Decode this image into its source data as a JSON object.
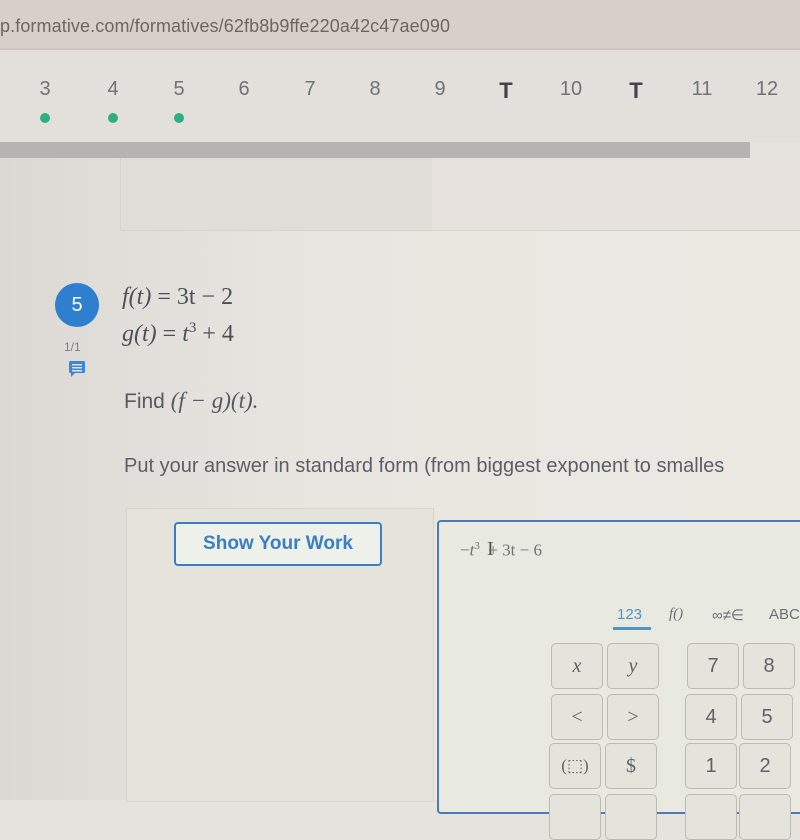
{
  "browser": {
    "url": "p.formative.com/formatives/62fb8b9ffe220a42c47ae090"
  },
  "question_nav": {
    "items": [
      {
        "label": "3",
        "answered": true
      },
      {
        "label": "4",
        "answered": true
      },
      {
        "label": "5",
        "answered": true
      },
      {
        "label": "6",
        "answered": false
      },
      {
        "label": "7",
        "answered": false
      },
      {
        "label": "8",
        "answered": false
      },
      {
        "label": "9",
        "answered": false
      },
      {
        "label": "T",
        "answered": false,
        "type": "text"
      },
      {
        "label": "10",
        "answered": false
      },
      {
        "label": "T",
        "answered": false,
        "type": "text"
      },
      {
        "label": "11",
        "answered": false
      },
      {
        "label": "12",
        "answered": false
      }
    ],
    "answered_color": "#2fae83"
  },
  "question": {
    "number": "5",
    "score": "1/1",
    "badge_color": "#2f7fd1",
    "f_def": {
      "lhs": "f(t)",
      "eq": "=",
      "rhs": "3t − 2"
    },
    "g_def": {
      "lhs": "g(t)",
      "eq": "=",
      "rhs_base": "t",
      "rhs_exp": "3",
      "rhs_tail": "+ 4"
    },
    "find_prefix": "Find",
    "find_expr": "(f − g)(t).",
    "instruction": "Put your answer in standard form (from biggest exponent to smalles"
  },
  "work": {
    "show_work_label": "Show Your Work"
  },
  "answer": {
    "prefix": "−",
    "base": "t",
    "exp": "3",
    "rest": "+ 3t − 6"
  },
  "keypad": {
    "tabs": [
      {
        "label": "123",
        "active": true
      },
      {
        "label": "f()",
        "active": false
      },
      {
        "label": "∞≠∈",
        "active": false
      },
      {
        "label": "ABC",
        "active": false
      }
    ],
    "keys": {
      "x": "x",
      "y": "y",
      "lt": "<",
      "gt": ">",
      "paren": "(⬚)",
      "dollar": "$",
      "seven": "7",
      "eight": "8",
      "four": "4",
      "five": "5",
      "one": "1",
      "two": "2"
    }
  }
}
